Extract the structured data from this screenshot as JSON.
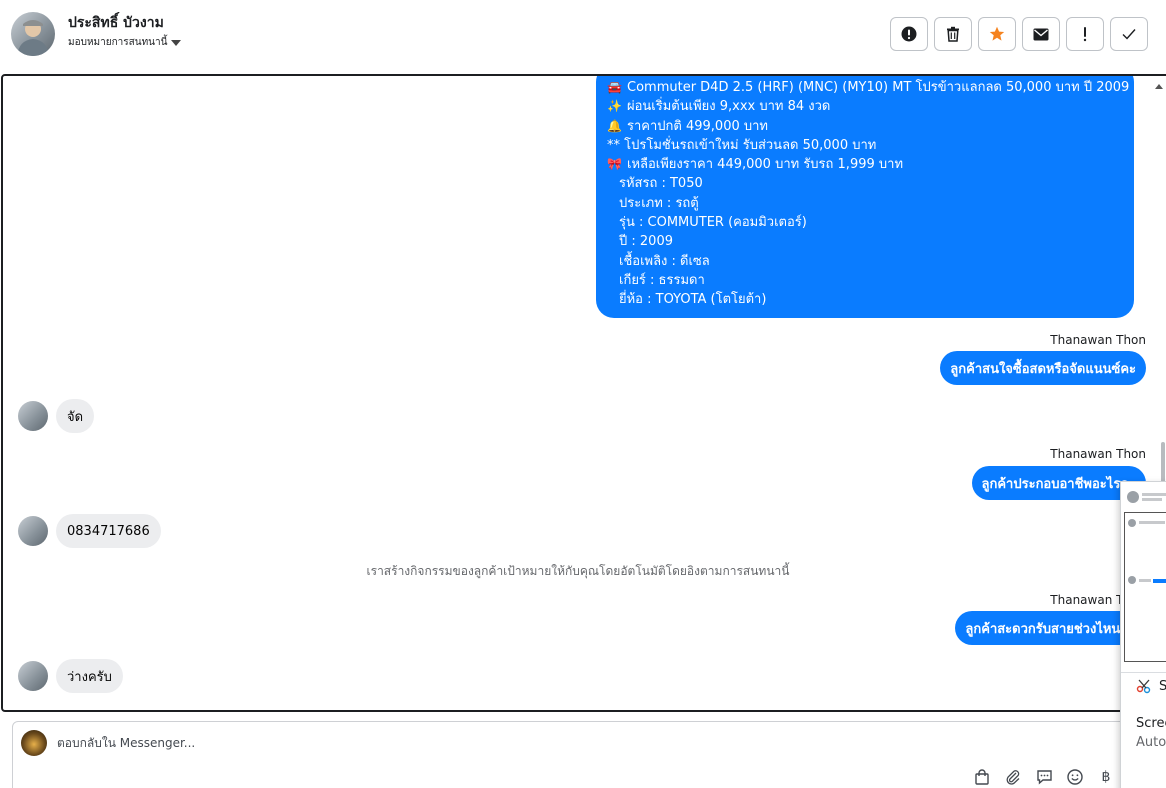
{
  "header": {
    "name": "ประสิทธิ์ บัวงาม",
    "assign_label": "มอบหมายการสนทนานี้",
    "actions": [
      {
        "icon": "alert-circle-icon"
      },
      {
        "icon": "trash-icon"
      },
      {
        "icon": "star-icon"
      },
      {
        "icon": "envelope-icon"
      },
      {
        "icon": "exclamation-icon"
      },
      {
        "icon": "check-icon"
      }
    ],
    "star_color": "#f5831f"
  },
  "conversation": {
    "outgoing_color": "#0a7cff",
    "listing_lines": [
      {
        "emoji": "🚘",
        "text": "Commuter D4D 2.5 (HRF) (MNC) (MY10) MT โปรข้าวแลกลด 50,000 บาท ปี 2009"
      },
      {
        "emoji": "✨",
        "text": "ผ่อนเริ่มต้นเพียง 9,xxx บาท  84 งวด"
      },
      {
        "emoji": "🔔",
        "text": "ราคาปกติ 499,000 บาท"
      },
      {
        "emoji": "",
        "text": "** โปรโมชั่นรถเข้าใหม่ รับส่วนลด 50,000 บาท"
      },
      {
        "emoji": "🎀",
        "text": "เหลือเพียงราคา 449,000 บาท รับรถ 1,999 บาท"
      },
      {
        "emoji": "",
        "text": "รหัสรถ : T050",
        "indent": true
      },
      {
        "emoji": "",
        "text": "ประเภท : รถตู้",
        "indent": true
      },
      {
        "emoji": "",
        "text": "รุ่น : COMMUTER (คอมมิวเตอร์)",
        "indent": true
      },
      {
        "emoji": "",
        "text": "ปี : 2009",
        "indent": true
      },
      {
        "emoji": "",
        "text": "เชื้อเพลิง : ดีเซล",
        "indent": true
      },
      {
        "emoji": "",
        "text": "เกียร์ : ธรรมดา",
        "indent": true
      },
      {
        "emoji": "",
        "text": "ยี่ห้อ : TOYOTA (โตโยต้า)",
        "indent": true
      }
    ],
    "messages": [
      {
        "sender": "Thanawan Thon",
        "text": "ลูกค้าสนใจซื้อสดหรือจัดแนนซ์คะ"
      },
      {
        "incoming": "จัด"
      },
      {
        "sender": "Thanawan Thon",
        "text": "ลูกค้าประกอบอาชีพอะไรคะ"
      },
      {
        "incoming": "0834717686"
      },
      {
        "system": "เราสร้างกิจกรรมของลูกค้าเป้าหมายให้กับคุณโดยอัตโนมัติโดยอิงตามการสนทนานี้"
      },
      {
        "sender": "Thanawan Thon",
        "text": "ลูกค้าสะดวกรับสายช่วงไหนคะ"
      },
      {
        "incoming": "ว่างครับ"
      }
    ]
  },
  "composer": {
    "placeholder": "ตอบกลับใน Messenger...",
    "tools": [
      "shopping-bag-icon",
      "paperclip-icon",
      "saved-reply-icon",
      "emoji-icon",
      "baht-icon"
    ],
    "baht_symbol": "฿"
  },
  "overlay": {
    "item_initial": "S",
    "line1": "Scree",
    "line2": "Auto"
  }
}
